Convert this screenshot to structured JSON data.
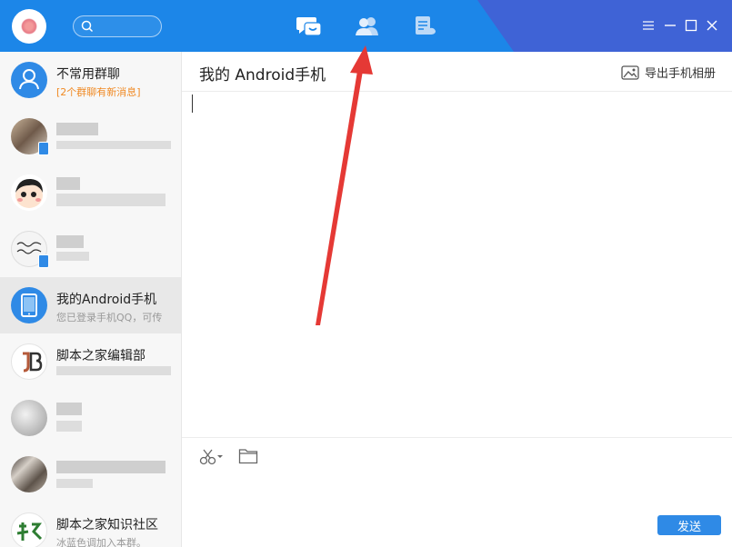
{
  "chat_header": {
    "title": "我的 Android手机",
    "export_label": "导出手机相册"
  },
  "conversations": [
    {
      "name": "不常用群聊",
      "sub": "[2个群聊有新消息]"
    },
    {
      "name": "我的Android手机",
      "sub": "您已登录手机QQ，可传"
    },
    {
      "name": "脚本之家编辑部",
      "sub": ""
    },
    {
      "name": "脚本之家知识社区",
      "sub": "冰蓝色调加入本群。"
    }
  ],
  "input": {
    "send_label": "发送"
  },
  "colors": {
    "accent": "#1c86e8",
    "send": "#2f8ae6",
    "annotation": "#e53935"
  }
}
